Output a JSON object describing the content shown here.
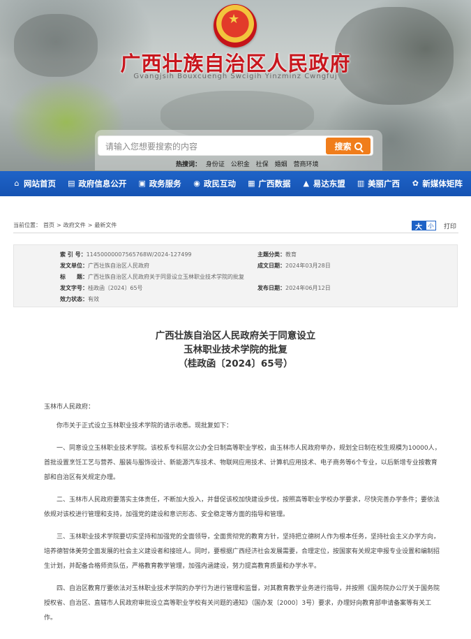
{
  "header": {
    "site_title": "广西壮族自治区人民政府",
    "site_subtitle": "Gvangjsih Bouxcuengh Swcigih Yinzminz Cwngfuj"
  },
  "search": {
    "placeholder": "请输入您想要搜索的内容",
    "button_label": "搜索",
    "hotwords_label": "热搜词：",
    "hotwords": [
      "身份证",
      "公积金",
      "社保",
      "婚姻",
      "营商环境"
    ]
  },
  "nav": {
    "items": [
      {
        "label": "网站首页",
        "icon": "home-icon"
      },
      {
        "label": "政府信息公开",
        "icon": "info-icon"
      },
      {
        "label": "政务服务",
        "icon": "service-icon"
      },
      {
        "label": "政民互动",
        "icon": "chat-icon"
      },
      {
        "label": "广西数据",
        "icon": "data-icon"
      },
      {
        "label": "易达东盟",
        "icon": "mountain-icon"
      },
      {
        "label": "美丽广西",
        "icon": "scenery-icon"
      },
      {
        "label": "新媒体矩阵",
        "icon": "media-icon"
      }
    ]
  },
  "breadcrumb": {
    "prefix": "当前位置：",
    "items": [
      "首页",
      ">",
      "政府文件",
      ">",
      "最新文件"
    ]
  },
  "tools": {
    "font_big": "大",
    "font_small": "小",
    "print": "打印"
  },
  "meta": {
    "index_label": "索 引 号：",
    "index_value": "11450000007565768W/2024-127499",
    "topic_label": "主题分类：",
    "topic_value": "教育",
    "issuer_label": "发文单位：",
    "issuer_value": "广西壮族自治区人民政府",
    "created_label": "成文日期：",
    "created_value": "2024年03月28日",
    "title_label": "标　　题：",
    "title_value": "广西壮族自治区人民政府关于同意设立玉林职业技术学院的批复",
    "docno_label": "发文字号：",
    "docno_value": "桂政函〔2024〕65号",
    "published_label": "发布日期：",
    "published_value": "2024年06月12日",
    "validity_label": "效力状态：",
    "validity_value": "有效"
  },
  "document": {
    "title_line1": "广西壮族自治区人民政府关于同意设立",
    "title_line2": "玉林职业技术学院的批复",
    "title_line3": "（桂政函〔2024〕65号）",
    "salutation": "玉林市人民政府：",
    "paragraphs": [
      "你市关于正式设立玉林职业技术学院的请示收悉。现批复如下：",
      "一、同意设立玉林职业技术学院。该校系专科层次公办全日制高等职业学校，由玉林市人民政府举办，规划全日制在校生规模为10000人，首批设置烹饪工艺与营养、服装与服饰设计、新能源汽车技术、物联网应用技术、计算机应用技术、电子商务等6个专业，以后新增专业按教育部和自治区有关规定办理。",
      "二、玉林市人民政府要落实主体责任，不断加大投入，并督促该校加快建设步伐，按照高等职业学校办学要求，尽快完善办学条件；要依法依规对该校进行管理和支持，加强党的建设和意识形态、安全稳定等方面的指导和管理。",
      "三、玉林职业技术学院要切实坚持和加强党的全面领导，全面贯彻党的教育方针，坚持把立德树人作为根本任务，坚持社会主义办学方向，培养德智体美劳全面发展的社会主义建设者和接班人。同时，要根据广西经济社会发展需要，合理定位，按国家有关规定申报专业设置和编制招生计划，并配备合格师资队伍，严格教育教学管理，加强内涵建设，努力提高教育质量和办学水平。",
      "四、自治区教育厅要依法对玉林职业技术学院的办学行为进行管理和监督，对其教育教学业务进行指导，并按照《国务院办公厅关于国务院授权省、自治区、直辖市人民政府审批设立高等职业学校有关问题的通知》（国办发〔2000〕3号）要求，办理好向教育部申请备案等有关工作。"
    ]
  }
}
